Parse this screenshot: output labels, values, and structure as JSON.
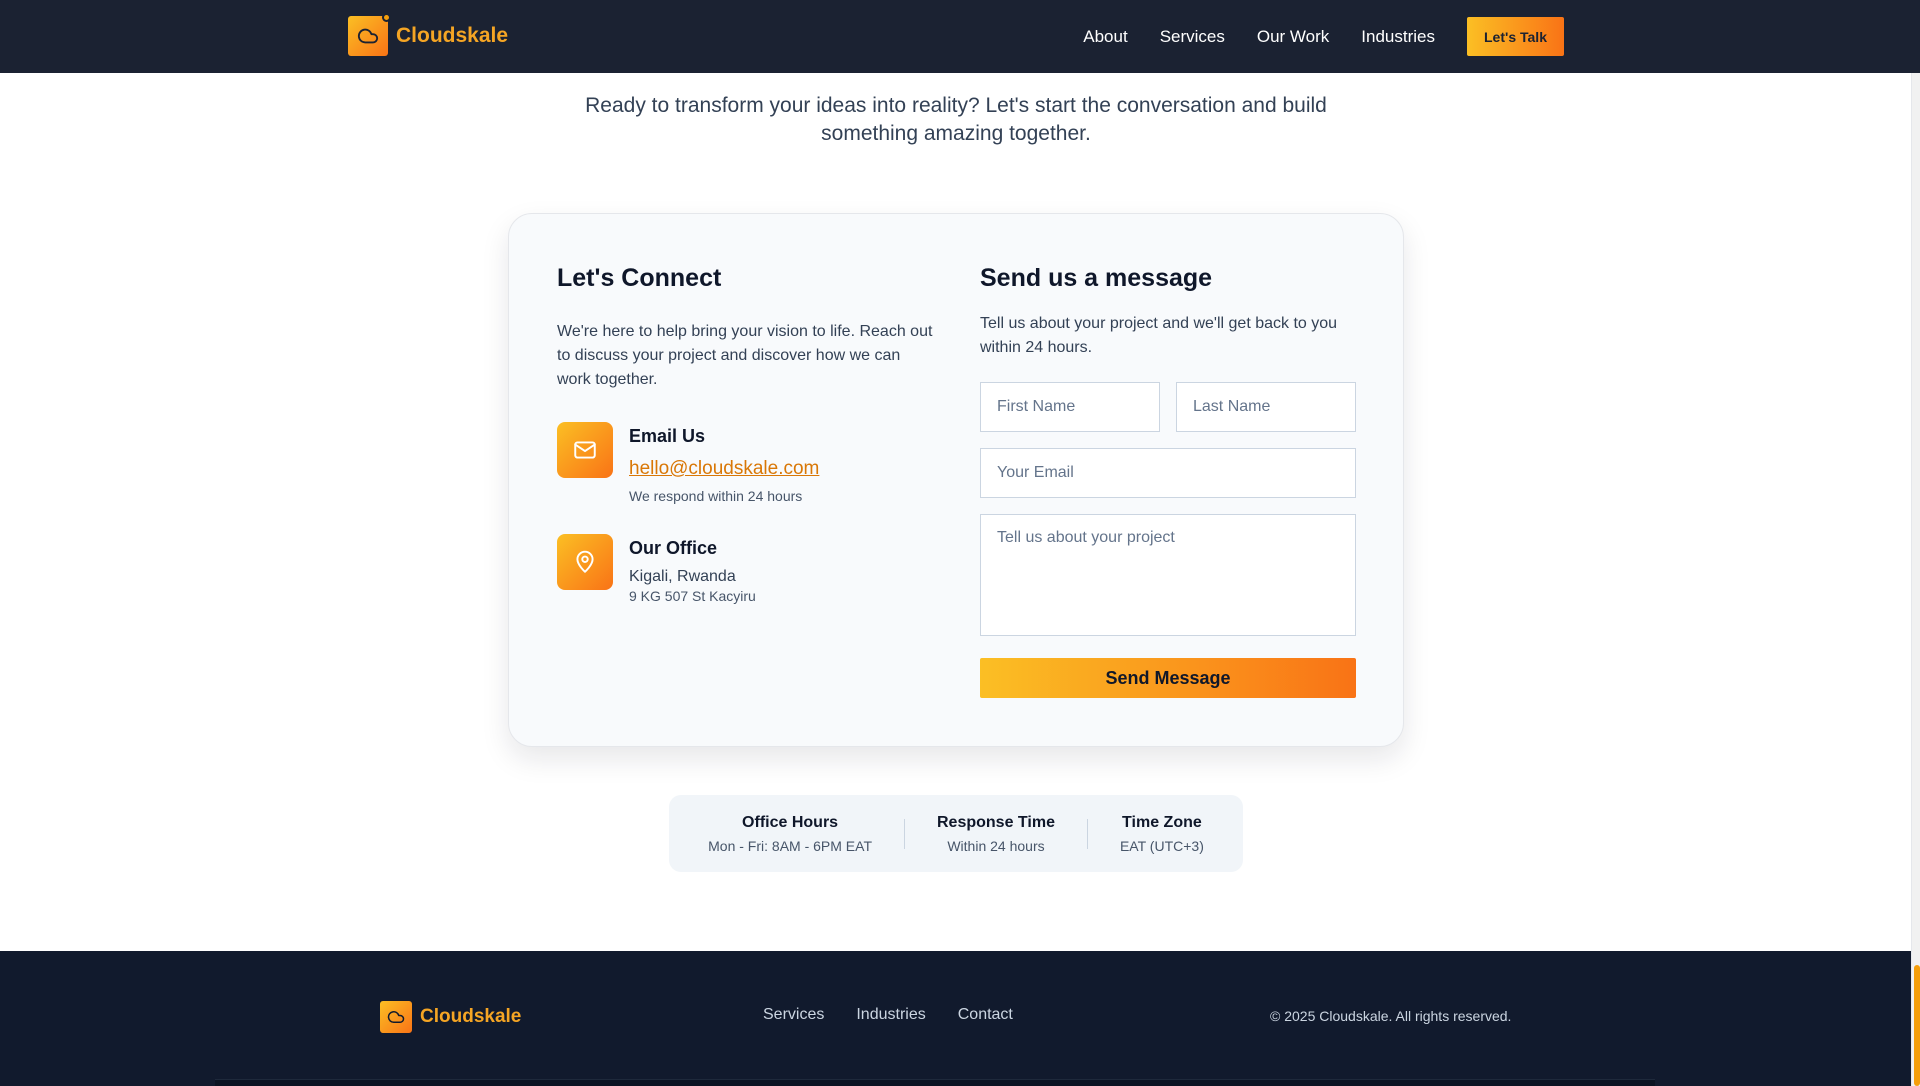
{
  "brand": {
    "name": "Cloudskale",
    "icon": "cloud-icon"
  },
  "nav": {
    "items": [
      "About",
      "Services",
      "Our Work",
      "Industries"
    ],
    "cta_label": "Let's Talk"
  },
  "intro": {
    "text": "Ready to transform your ideas into reality? Let's start the conversation and build something amazing together."
  },
  "connect": {
    "title": "Let's Connect",
    "description": "We're here to help bring your vision to life. Reach out to discuss your project and discover how we can work together.",
    "email": {
      "title": "Email Us",
      "address": "hello@cloudskale.com",
      "note": "We respond within 24 hours",
      "icon": "mail-icon"
    },
    "office": {
      "title": "Our Office",
      "place": "Kigali, Rwanda",
      "address": "9 KG 507 St Kacyiru",
      "icon": "map-pin-icon"
    }
  },
  "form": {
    "title": "Send us a message",
    "description": "Tell us about your project and we'll get back to you within 24 hours.",
    "first_name": {
      "placeholder": "First Name",
      "value": ""
    },
    "last_name": {
      "placeholder": "Last Name",
      "value": ""
    },
    "email": {
      "placeholder": "Your Email",
      "value": ""
    },
    "message": {
      "placeholder": "Tell us about your project",
      "value": ""
    },
    "submit_label": "Send Message"
  },
  "stats": [
    {
      "title": "Office Hours",
      "value": "Mon - Fri: 8AM - 6PM EAT"
    },
    {
      "title": "Response Time",
      "value": "Within 24 hours"
    },
    {
      "title": "Time Zone",
      "value": "EAT (UTC+3)"
    }
  ],
  "footer": {
    "brand": "Cloudskale",
    "links": [
      "Services",
      "Industries",
      "Contact"
    ],
    "copyright": "© 2025 Cloudskale. All rights reserved."
  },
  "colors": {
    "accent": "#f59e0b",
    "accent_end": "#f97316",
    "nav_bg": "#1b2232",
    "footer_bg": "#111a2d",
    "link": "#d97706"
  }
}
